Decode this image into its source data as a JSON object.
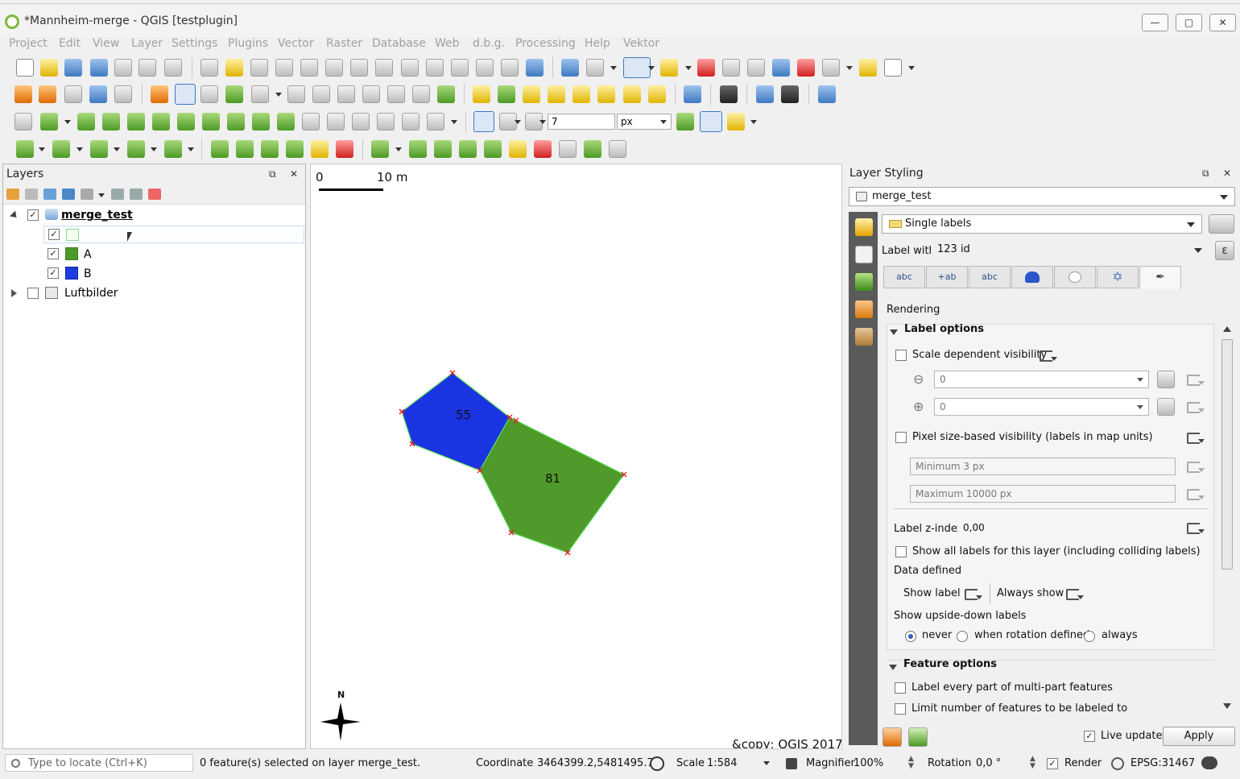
{
  "window": {
    "title": "*Mannheim-merge - QGIS [testplugin]",
    "minimize": "—",
    "maximize": "▢",
    "close": "✕"
  },
  "menu": [
    "Project",
    "Edit",
    "View",
    "Layer",
    "Settings",
    "Plugins",
    "Vector",
    "Raster",
    "Database",
    "Web",
    "d.b.g.",
    "Processing",
    "Help",
    "Vektor"
  ],
  "toolbar": {
    "snap_tolerance": "7",
    "snap_unit": "px"
  },
  "layers_panel": {
    "title": "Layers",
    "tree": [
      {
        "label": "merge_test",
        "checked": true,
        "expanded": true
      },
      {
        "label": "",
        "checked": true,
        "color": "#f4fff0"
      },
      {
        "label": "A",
        "checked": true,
        "color": "#4c9a2a"
      },
      {
        "label": "B",
        "checked": true,
        "color": "#1a3ce0"
      },
      {
        "label": "Luftbilder",
        "checked": false,
        "expanded": false
      }
    ]
  },
  "map": {
    "scalebar_left": "0",
    "scalebar_right": "10 m",
    "feature_labels": [
      "55",
      "81"
    ],
    "north": "N",
    "copyright": "&copy; QGIS 2017",
    "colors": {
      "blue_polygon": "#1a34e2",
      "green_polygon": "#4f9a2b",
      "outline": "#5fe05f",
      "vertex": "#e02020"
    }
  },
  "styling": {
    "title": "Layer Styling",
    "layer_combo": "merge_test",
    "renderer_combo": "Single labels",
    "label_with_caption": "Label with",
    "label_with_value": "123 id",
    "tabs": [
      "abc",
      "+ab",
      "abc",
      "",
      "",
      "",
      ""
    ],
    "section_header": "Rendering",
    "label_options": {
      "header": "Label options",
      "scale_vis": "Scale dependent visibility",
      "min_scale": "0",
      "max_scale": "0",
      "pixel_vis": "Pixel size-based visibility (labels in map units)",
      "min_px": "Minimum 3 px",
      "max_px": "Maximum 10000 px",
      "zindex_label": "Label z-index",
      "zindex_value": "0,00",
      "show_all": "Show all labels for this layer (including colliding labels)",
      "data_defined": "Data defined",
      "show_label": "Show label",
      "always_show": "Always show",
      "upside_down": "Show upside-down labels",
      "never": "never",
      "when_rotation": "when rotation defined",
      "always": "always"
    },
    "feature_options": {
      "header": "Feature options",
      "every_part": "Label every part of multi-part features",
      "limit": "Limit number of features to be labeled to"
    },
    "live_update": "Live update",
    "apply": "Apply"
  },
  "statusbar": {
    "locate_placeholder": "Type to locate (Ctrl+K)",
    "message": "0 feature(s) selected on layer merge_test.",
    "coordinate_label": "Coordinate",
    "coordinate_value": "3464399.2,5481495.7",
    "scale_label": "Scale",
    "scale_value": "1:584",
    "magnifier_label": "Magnifier",
    "magnifier_value": "100%",
    "rotation_label": "Rotation",
    "rotation_value": "0,0 °",
    "render_label": "Render",
    "crs": "EPSG:31467"
  }
}
